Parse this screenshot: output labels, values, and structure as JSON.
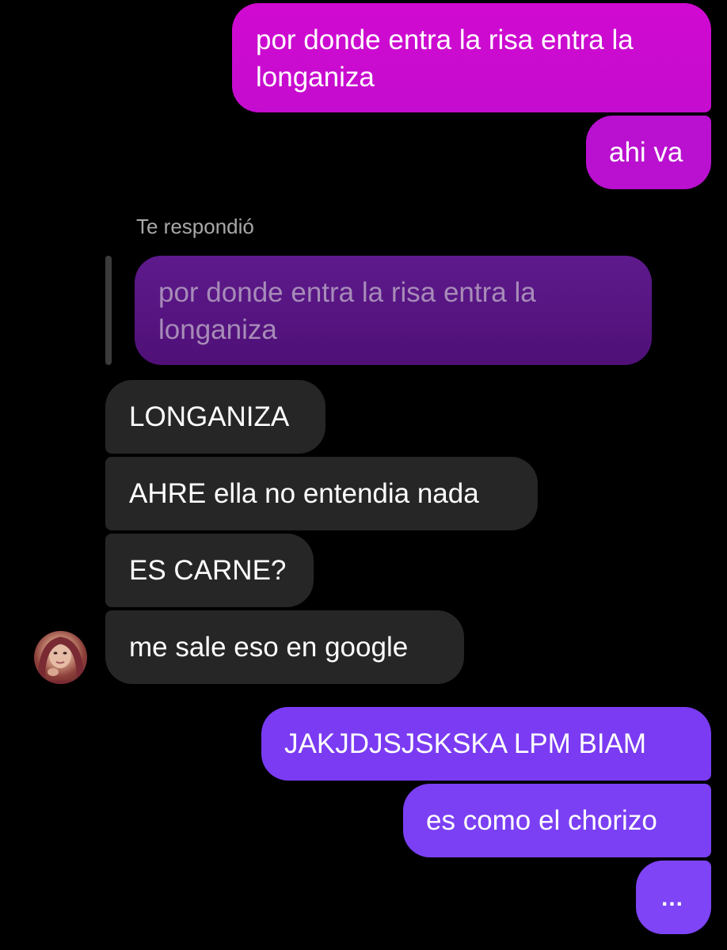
{
  "messages": {
    "sent_1": "por donde entra la risa entra la longaniza",
    "sent_2": "ahi va",
    "reply_label": "Te respondió",
    "reply_quote": "por donde entra la risa entra la longaniza",
    "received": [
      "LONGANIZA",
      "AHRE ella no entendia nada",
      "ES CARNE?",
      "me sale eso en google"
    ],
    "sent_3": "JAKJDJSJSKSKA LPM BIAM",
    "sent_4": "es como el chorizo",
    "sent_5": "..."
  },
  "colors": {
    "background": "#000000",
    "sent_magenta": "#c40ccf",
    "sent_purple": "#7a3bf2",
    "received_gray": "#262626",
    "reply_quote": "#5e1a8c"
  },
  "icons": {
    "avatar": "contact-avatar-photo"
  }
}
